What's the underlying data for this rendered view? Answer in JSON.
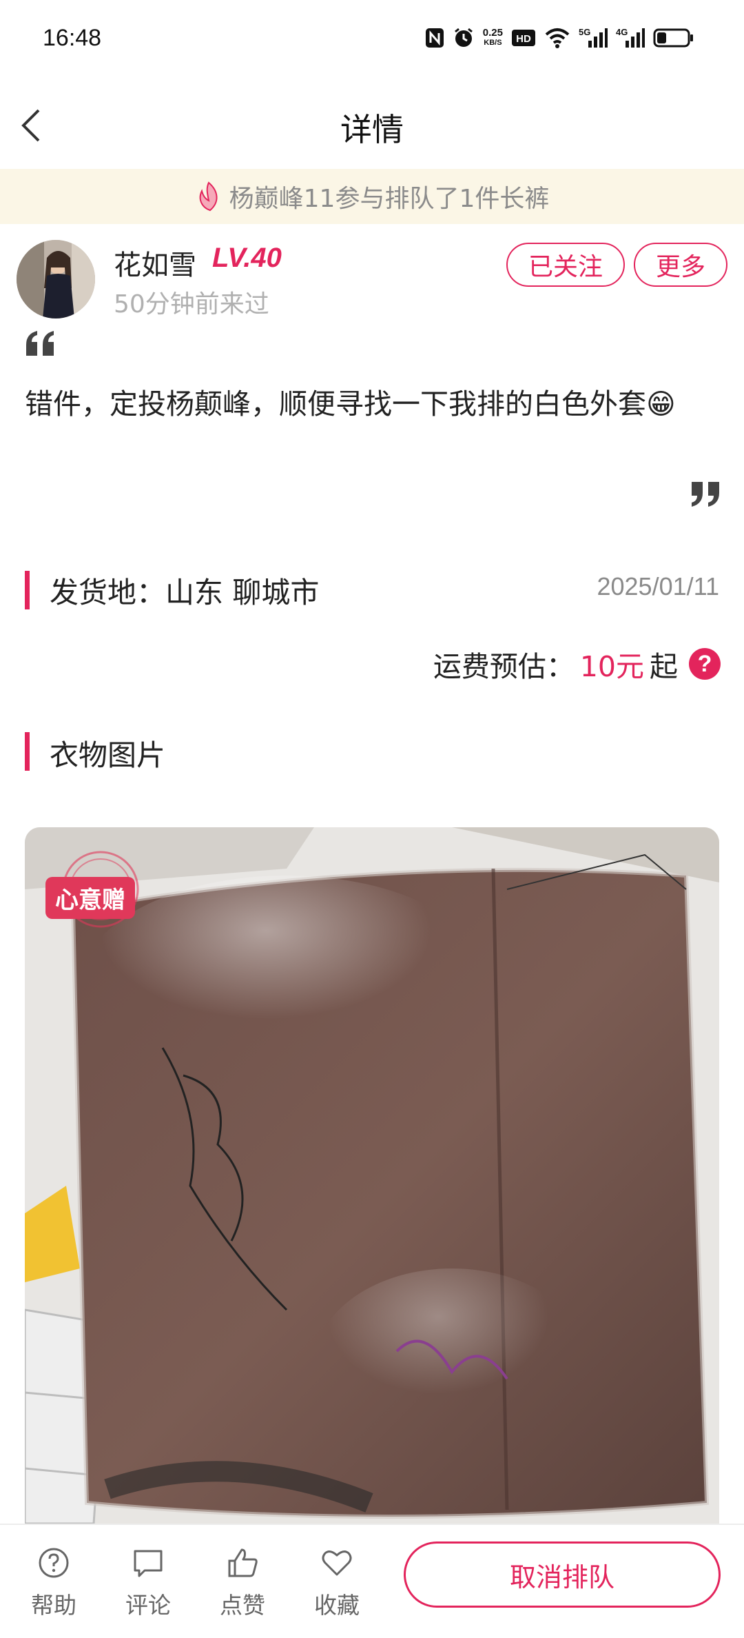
{
  "status_bar": {
    "time": "16:48",
    "net_speed_value": "0.25",
    "net_speed_unit": "KB/S",
    "hd_label": "HD",
    "sim1_label": "5G",
    "sim2_label": "4G",
    "icons": [
      "nfc-icon",
      "alarm-icon",
      "hd-voice-icon",
      "wifi-icon",
      "signal-5g-icon",
      "signal-4g-icon",
      "battery-icon"
    ],
    "battery_level": 0.3
  },
  "nav": {
    "title": "详情"
  },
  "notice": {
    "text": "杨巅峰11参与排队了1件长裤"
  },
  "user": {
    "name": "花如雪",
    "level": "LV.40",
    "last_seen": "50分钟前来过",
    "follow_label": "已关注",
    "more_label": "更多"
  },
  "post": {
    "text": "错件，定投杨颠峰，顺便寻找一下我排的白色外套😁"
  },
  "shipping": {
    "origin_label": "发货地：山东 聊城市",
    "date": "2025/01/11",
    "fee_label": "运费预估：",
    "fee_value": "10元",
    "fee_suffix": "起",
    "help_glyph": "?"
  },
  "photos": {
    "title": "衣物图片",
    "badge": "心意赠"
  },
  "bottom": {
    "help": "帮助",
    "comment": "评论",
    "like": "点赞",
    "favorite": "收藏",
    "cancel": "取消排队"
  },
  "colors": {
    "accent": "#e3245c",
    "notice_bg": "#fbf6e6"
  }
}
